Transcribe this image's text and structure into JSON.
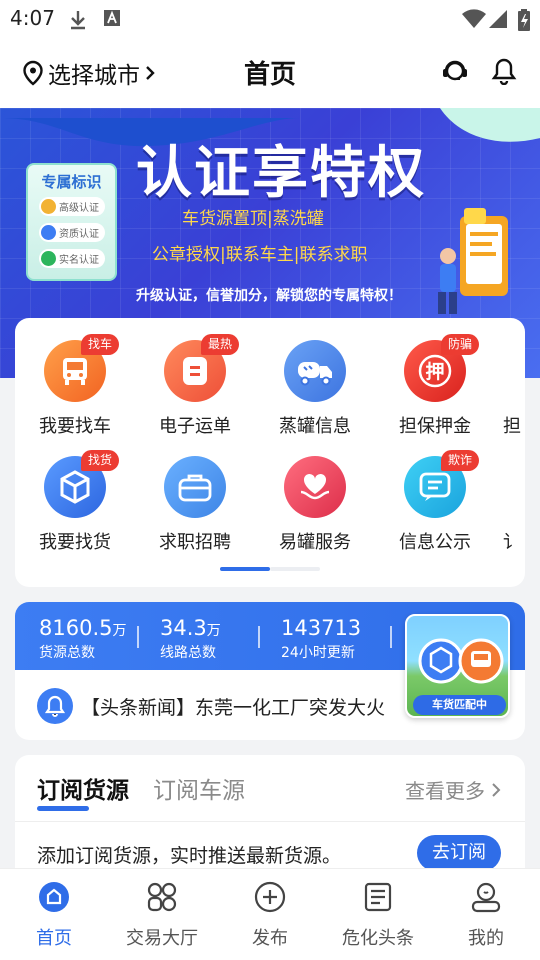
{
  "status_bar": {
    "time": "4:07"
  },
  "header": {
    "city_label": "选择城市",
    "title": "首页"
  },
  "banner": {
    "badge_title": "专属标识",
    "badges": [
      "高级认证",
      "资质认证",
      "实名认证"
    ],
    "headline": "认证享特权",
    "line1": "车货源置顶|蒸洗罐",
    "line2": "公章授权|联系车主|联系求职",
    "line3": "升级认证，信誉加分，解锁您的专属特权！"
  },
  "categories": {
    "row1": [
      {
        "label": "我要找车",
        "tag": "找车",
        "icon": "bus-icon",
        "color": "#f47a33"
      },
      {
        "label": "电子运单",
        "tag": "最热",
        "icon": "waybill-icon",
        "color": "#f26a4a"
      },
      {
        "label": "蒸罐信息",
        "tag": "",
        "icon": "tanker-truck-icon",
        "color": "#4a86ea"
      },
      {
        "label": "担保押金",
        "tag": "防骗",
        "icon": "deposit-icon",
        "color": "#e7322b"
      }
    ],
    "row2": [
      {
        "label": "我要找货",
        "tag": "找货",
        "icon": "box-icon",
        "color": "#3d7df3"
      },
      {
        "label": "求职招聘",
        "tag": "",
        "icon": "briefcase-icon",
        "color": "#4a90ea"
      },
      {
        "label": "易罐服务",
        "tag": "",
        "icon": "heart-hand-icon",
        "color": "#e9415a"
      },
      {
        "label": "信息公示",
        "tag": "欺诈",
        "icon": "chat-info-icon",
        "color": "#22b6e6"
      }
    ]
  },
  "stats": {
    "items": [
      {
        "value": "8160.5",
        "unit": "万",
        "caption": "货源总数"
      },
      {
        "value": "34.3",
        "unit": "万",
        "caption": "线路总数"
      },
      {
        "value": "143713",
        "unit": "",
        "caption": "24小时更新"
      }
    ],
    "news_text": "【头条新闻】东莞一化工厂突发大火",
    "match_label": "车货匹配中"
  },
  "subscription": {
    "tab_active": "订阅货源",
    "tab_inactive": "订阅车源",
    "more": "查看更多",
    "prompt": "添加订阅货源，实时推送最新货源。",
    "button": "去订阅"
  },
  "nav": [
    {
      "label": "首页",
      "icon": "home-icon",
      "active": true
    },
    {
      "label": "交易大厅",
      "icon": "grid-icon",
      "active": false
    },
    {
      "label": "发布",
      "icon": "plus-circle-icon",
      "active": false
    },
    {
      "label": "危化头条",
      "icon": "news-icon",
      "active": false
    },
    {
      "label": "我的",
      "icon": "profile-icon",
      "active": false
    }
  ],
  "colors": {
    "primary": "#2f6de8",
    "tag_red": "#ec3c32",
    "banner_yellow": "#ffd84a"
  }
}
